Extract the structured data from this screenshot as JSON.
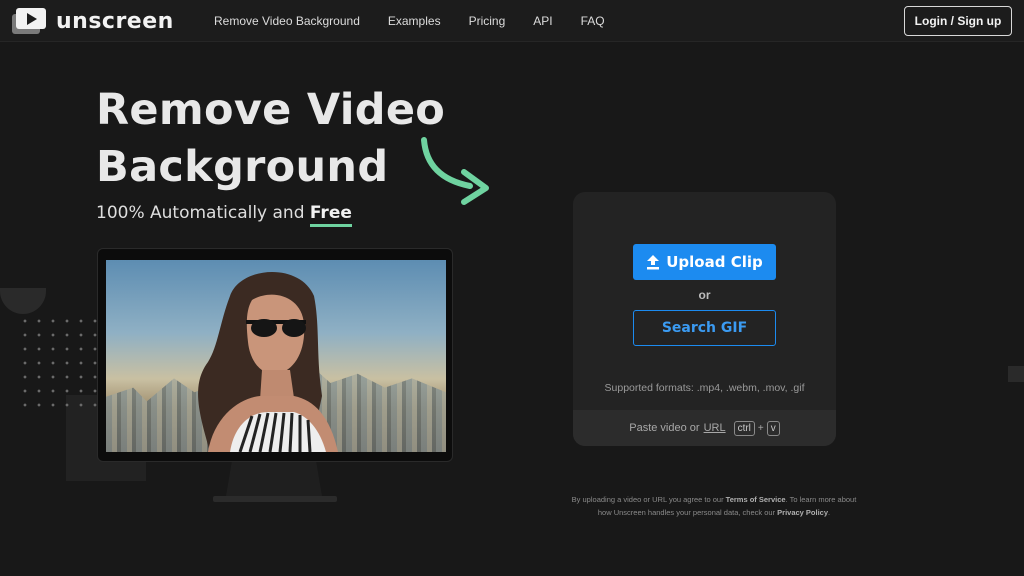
{
  "brand": {
    "name": "unscreen"
  },
  "nav": {
    "links": [
      "Remove Video Background",
      "Examples",
      "Pricing",
      "API",
      "FAQ"
    ],
    "login_label": "Login / Sign up"
  },
  "hero": {
    "title_line1": "Remove Video",
    "title_line2": "Background",
    "subtitle_prefix": "100% Automatically and",
    "subtitle_emphasis": "Free"
  },
  "upload": {
    "upload_label": "Upload Clip",
    "or_label": "or",
    "search_gif_label": "Search GIF",
    "formats": "Supported formats: .mp4, .webm, .mov, .gif",
    "paste_prefix": "Paste video or",
    "paste_url": "URL",
    "key_ctrl": "ctrl",
    "key_plus": "+",
    "key_v": "v"
  },
  "legal": {
    "part1": "By uploading a video or URL you agree to our",
    "tos": "Terms of Service",
    "part2": ". To learn more about how Unscreen handles your personal data, check our",
    "privacy": "Privacy Policy",
    "part3": "."
  },
  "colors": {
    "accent": "#1c8bf0",
    "highlight": "#6fd3a0",
    "background": "#181818"
  }
}
